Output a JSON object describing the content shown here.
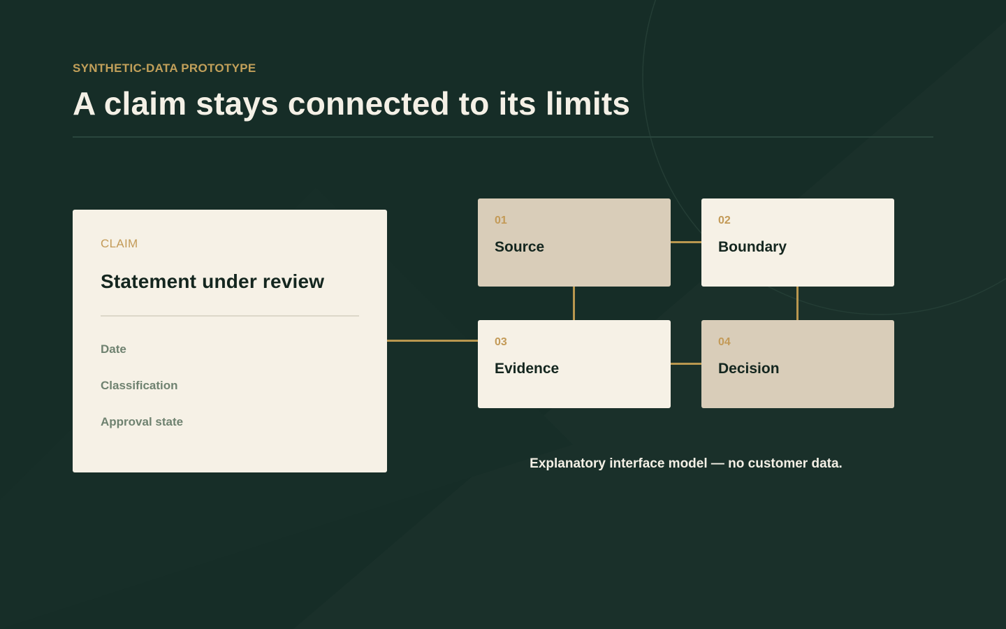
{
  "header": {
    "eyebrow": "SYNTHETIC-DATA PROTOTYPE",
    "title": "A claim stays connected to its limits"
  },
  "claim": {
    "label": "CLAIM",
    "title": "Statement under review",
    "fields": [
      "Date",
      "Classification",
      "Approval state"
    ]
  },
  "nodes": [
    {
      "number": "01",
      "label": "Source"
    },
    {
      "number": "02",
      "label": "Boundary"
    },
    {
      "number": "03",
      "label": "Evidence"
    },
    {
      "number": "04",
      "label": "Decision"
    }
  ],
  "footnote": "Explanatory interface model — no customer data.",
  "colors": {
    "background": "#162d27",
    "accent": "#c2a05a",
    "card_light": "#f6f1e6",
    "card_tan": "#d9cdb9",
    "connector": "#b9974f"
  }
}
